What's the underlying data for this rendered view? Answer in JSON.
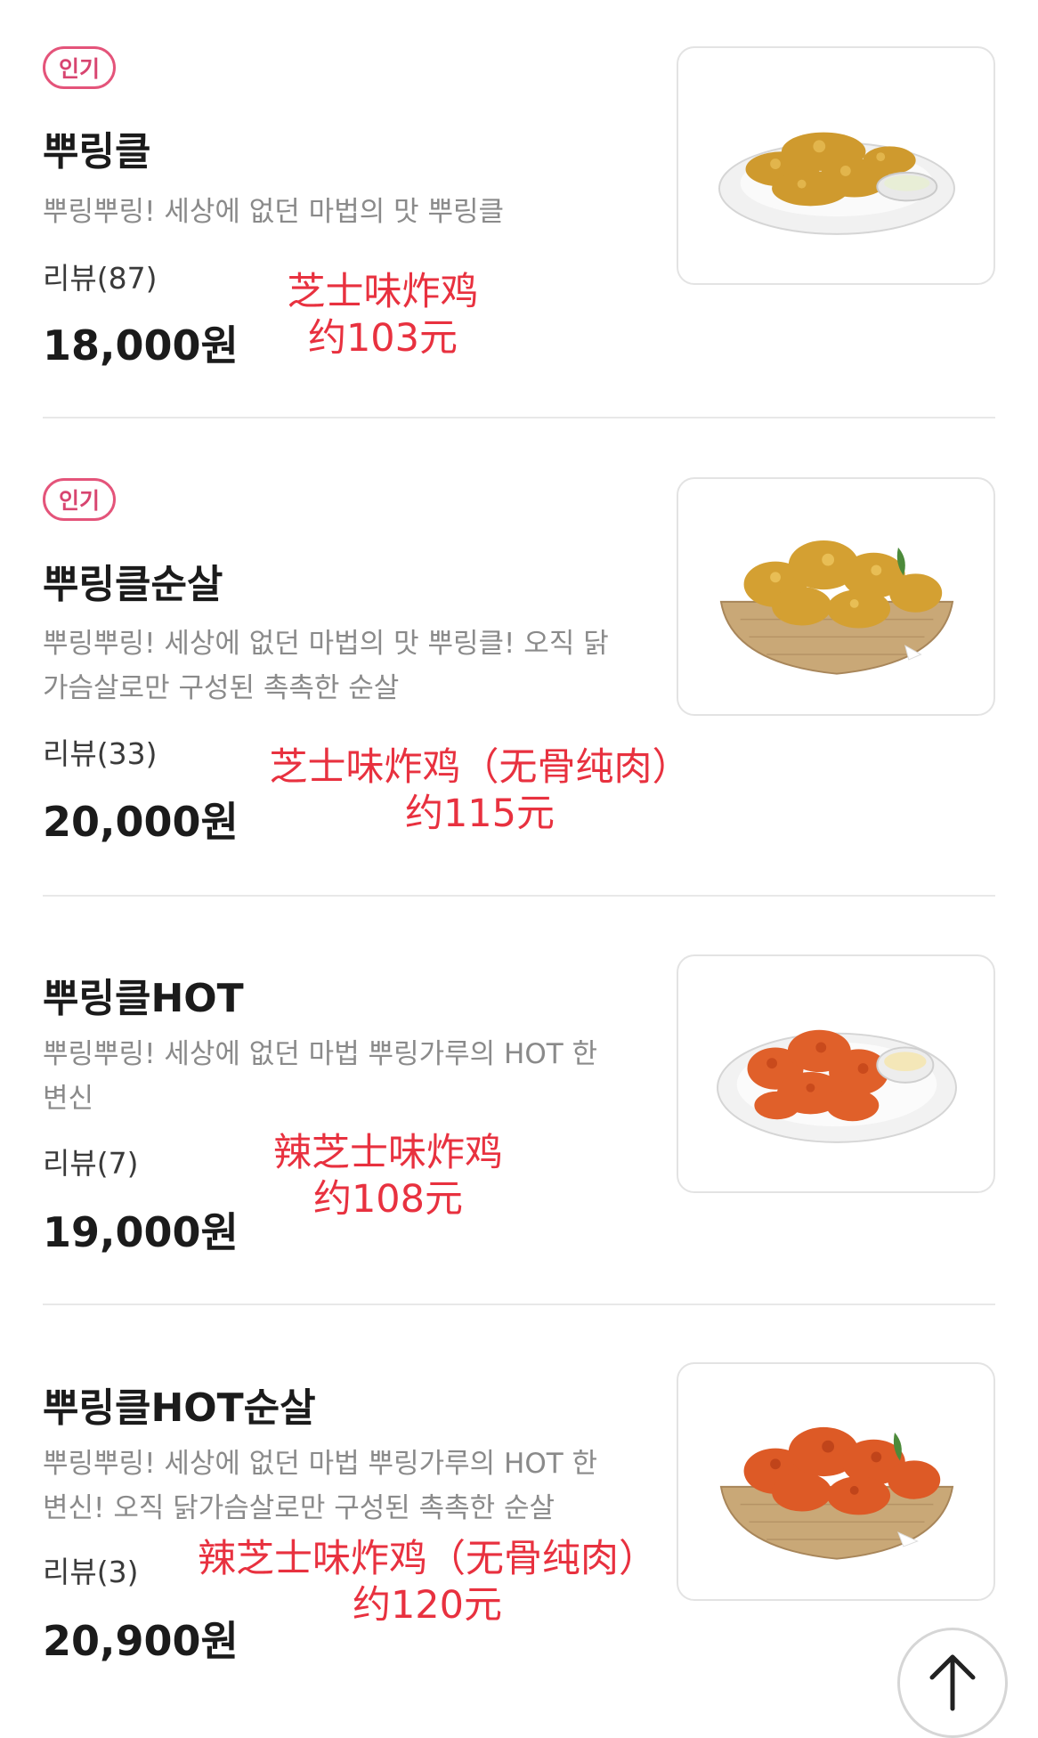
{
  "items": [
    {
      "badge": "인기",
      "name": "뿌링클",
      "desc": "뿌링뿌링! 세상에 없던 마법의 맛 뿌링클",
      "review": "리뷰(87)",
      "price": "18,000원",
      "note_line1": "芝士味炸鸡",
      "note_line2": "约103元"
    },
    {
      "badge": "인기",
      "name": "뿌링클순살",
      "desc": "뿌링뿌링! 세상에 없던 마법의 맛 뿌링클! 오직 닭가슴살로만 구성된 촉촉한 순살",
      "review": "리뷰(33)",
      "price": "20,000원",
      "note_line1": "芝士味炸鸡（无骨纯肉）",
      "note_line2": "约115元"
    },
    {
      "name": "뿌링클HOT",
      "desc": "뿌링뿌링! 세상에 없던 마법 뿌링가루의 HOT 한 변신",
      "review": "리뷰(7)",
      "price": "19,000원",
      "note_line1": "辣芝士味炸鸡",
      "note_line2": "约108元"
    },
    {
      "name": "뿌링클HOT순살",
      "desc": "뿌링뿌링! 세상에 없던 마법 뿌링가루의 HOT 한 변신! 오직 닭가슴살로만 구성된 촉촉한 순살",
      "review": "리뷰(3)",
      "price": "20,900원",
      "note_line1": "辣芝士味炸鸡（无骨纯肉）",
      "note_line2": "约120元"
    }
  ],
  "icons": {
    "scroll_top": "arrow-up-icon"
  },
  "colors": {
    "badge": "#e4547a",
    "note": "#e8313f",
    "fried_plain": "#d9a43a",
    "fried_hot": "#e0602a"
  }
}
